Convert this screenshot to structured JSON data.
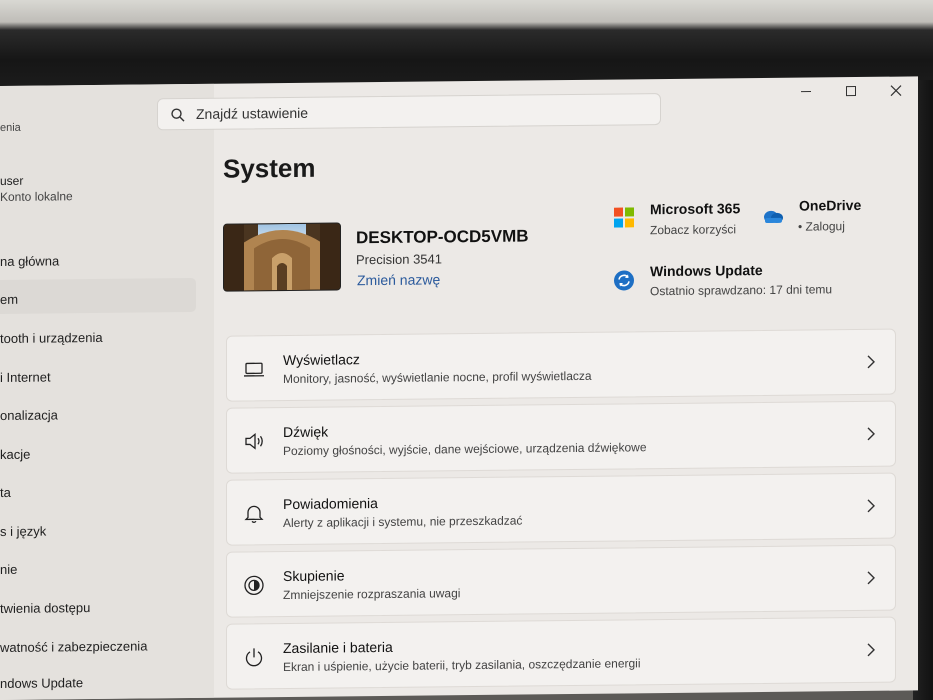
{
  "search": {
    "placeholder": "Znajdź ustawienie"
  },
  "sidebar": {
    "partial_top": "enia",
    "user": {
      "name": "user",
      "account": "Konto lokalne"
    },
    "items": [
      {
        "label": "na główna"
      },
      {
        "label": "em",
        "selected": true
      },
      {
        "label": "tooth i urządzenia"
      },
      {
        "label": "i Internet"
      },
      {
        "label": "onalizacja"
      },
      {
        "label": "kacje"
      },
      {
        "label": "ta"
      },
      {
        "label": "s i język"
      },
      {
        "label": "nie"
      },
      {
        "label": "twienia dostępu"
      },
      {
        "label": "watność i zabezpieczenia"
      },
      {
        "label": "ndows Update"
      }
    ]
  },
  "page": {
    "title": "System"
  },
  "device": {
    "name": "DESKTOP-OCD5VMB",
    "model": "Precision 3541",
    "rename": "Zmień nazwę"
  },
  "tiles": {
    "m365": {
      "title": "Microsoft 365",
      "sub": "Zobacz korzyści"
    },
    "onedrive": {
      "title": "OneDrive",
      "sub": "• Zaloguj"
    },
    "update": {
      "title": "Windows Update",
      "sub": "Ostatnio sprawdzano: 17 dni temu"
    }
  },
  "cards": [
    {
      "title": "Wyświetlacz",
      "desc": "Monitory, jasność, wyświetlanie nocne, profil wyświetlacza",
      "icon": "display-icon"
    },
    {
      "title": "Dźwięk",
      "desc": "Poziomy głośności, wyjście, dane wejściowe, urządzenia dźwiękowe",
      "icon": "speaker-icon"
    },
    {
      "title": "Powiadomienia",
      "desc": "Alerty z aplikacji i systemu, nie przeszkadzać",
      "icon": "bell-icon"
    },
    {
      "title": "Skupienie",
      "desc": "Zmniejszenie rozpraszania uwagi",
      "icon": "focus-icon"
    },
    {
      "title": "Zasilanie i bateria",
      "desc": "Ekran i uśpienie, użycie baterii, tryb zasilania, oszczędzanie energii",
      "icon": "power-icon"
    }
  ],
  "colors": {
    "accent": "#2b5a9c",
    "window_bg": "#ece9e6",
    "card_bg": "#f3f1ef"
  }
}
